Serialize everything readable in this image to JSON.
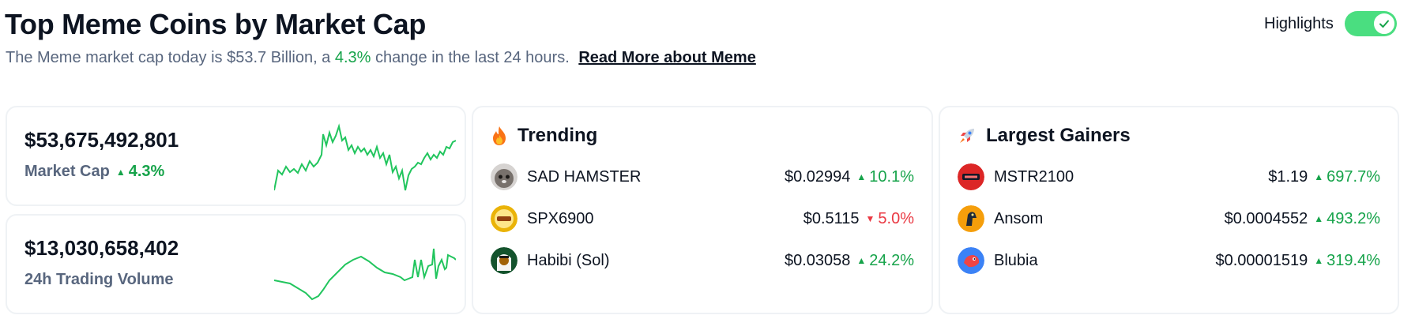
{
  "header": {
    "title": "Top Meme Coins by Market Cap",
    "subtitle_pre": "The Meme market cap today is $53.7 Billion, a",
    "subtitle_pct": "4.3%",
    "subtitle_post": "change in the last 24 hours.",
    "read_more": "Read More about Meme"
  },
  "highlights": {
    "label": "Highlights",
    "enabled": true
  },
  "market_cap": {
    "value": "$53,675,492,801",
    "label": "Market Cap",
    "change": "4.3%",
    "direction": "up"
  },
  "volume": {
    "value": "$13,030,658,402",
    "label": "24h Trading Volume"
  },
  "trending": {
    "title": "Trending",
    "icon": "fire-icon",
    "items": [
      {
        "name": "SAD HAMSTER",
        "price": "$0.02994",
        "change": "10.1%",
        "direction": "up"
      },
      {
        "name": "SPX6900",
        "price": "$0.5115",
        "change": "5.0%",
        "direction": "down"
      },
      {
        "name": "Habibi (Sol)",
        "price": "$0.03058",
        "change": "24.2%",
        "direction": "up"
      }
    ]
  },
  "gainers": {
    "title": "Largest Gainers",
    "icon": "rocket-icon",
    "items": [
      {
        "name": "MSTR2100",
        "price": "$1.19",
        "change": "697.7%",
        "direction": "up"
      },
      {
        "name": "Ansom",
        "price": "$0.0004552",
        "change": "493.2%",
        "direction": "up"
      },
      {
        "name": "Blubia",
        "price": "$0.00001519",
        "change": "319.4%",
        "direction": "up"
      }
    ]
  },
  "colors": {
    "up": "#16a34a",
    "down": "#ea3943",
    "sparkline": "#22c55e",
    "muted": "#58667e"
  }
}
